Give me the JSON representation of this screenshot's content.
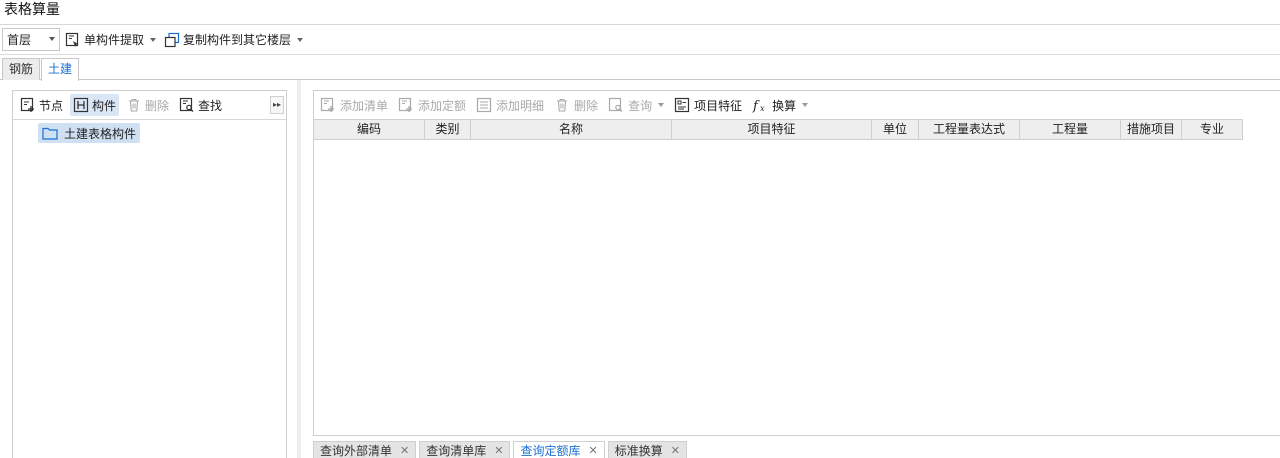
{
  "window": {
    "title": "表格算量"
  },
  "toolbar": {
    "floor_value": "首层",
    "extract_label": "单构件提取",
    "copy_label": "复制构件到其它楼层"
  },
  "tabs": [
    {
      "label": "钢筋",
      "active": false
    },
    {
      "label": "土建",
      "active": true
    }
  ],
  "left_panel": {
    "buttons": {
      "node": "节点",
      "component": "构件",
      "delete": "删除",
      "find": "查找"
    },
    "tree": [
      {
        "label": "土建表格构件",
        "icon": "folder-icon"
      }
    ]
  },
  "right_panel": {
    "buttons": {
      "add_list": "添加清单",
      "add_quota": "添加定额",
      "add_detail": "添加明细",
      "delete": "删除",
      "query": "查询",
      "item_feature": "项目特征",
      "convert": "换算"
    },
    "columns": [
      "编码",
      "类别",
      "名称",
      "项目特征",
      "单位",
      "工程量表达式",
      "工程量",
      "措施项目",
      "专业"
    ]
  },
  "bottom_tabs": [
    {
      "label": "查询外部清单",
      "active": false
    },
    {
      "label": "查询清单库",
      "active": false
    },
    {
      "label": "查询定额库",
      "active": true
    },
    {
      "label": "标准换算",
      "active": false
    }
  ],
  "colors": {
    "accent": "#1a6fd4",
    "selected_bg": "#cfe0f3",
    "disabled": "#a9a9a9"
  }
}
